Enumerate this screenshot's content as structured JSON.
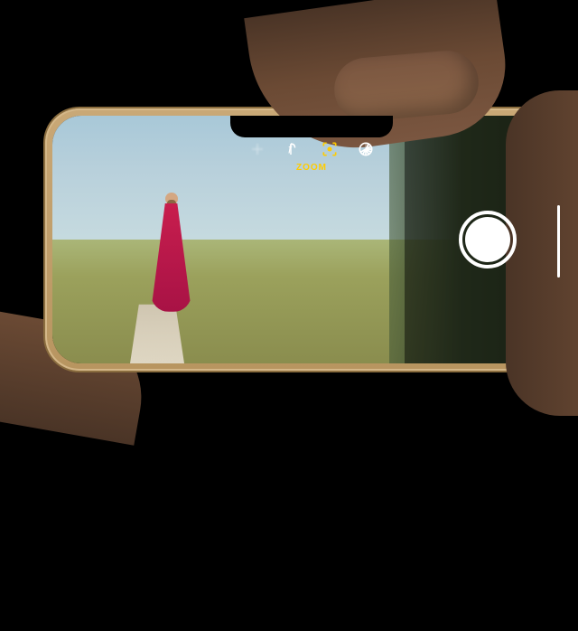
{
  "camera": {
    "zoom_label": "ZOOM",
    "active_mode_color": "#ffcc00"
  }
}
